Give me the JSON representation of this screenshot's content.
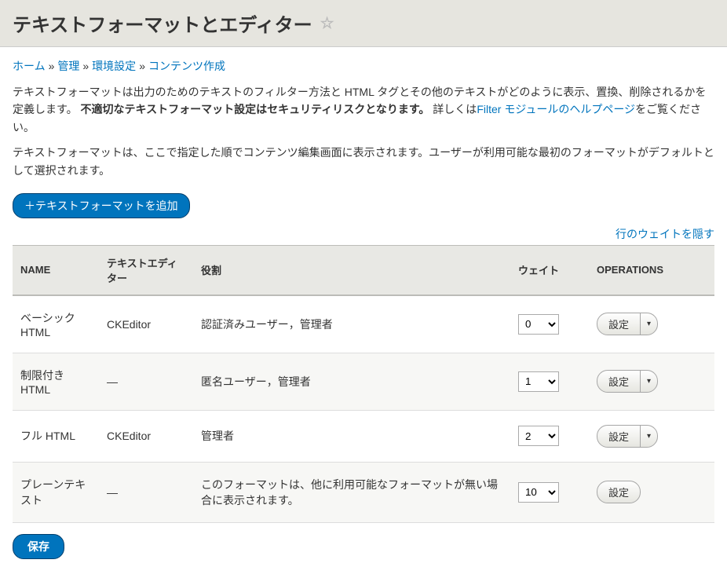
{
  "page": {
    "title": "テキストフォーマットとエディター"
  },
  "breadcrumb": {
    "items": [
      {
        "label": "ホーム"
      },
      {
        "label": "管理"
      },
      {
        "label": "環境設定"
      },
      {
        "label": "コンテンツ作成"
      }
    ],
    "sep": "»"
  },
  "desc": {
    "p1a": "テキストフォーマットは出力のためのテキストのフィルター方法と HTML タグとその他のテキストがどのように表示、置換、削除されるかを定義します。",
    "p1bold": "不適切なテキストフォーマット設定はセキュリティリスクとなります。",
    "p1b": " 詳しくは",
    "p1link": "Filter モジュールのヘルプページ",
    "p1c": "をご覧ください。",
    "p2": "テキストフォーマットは、ここで指定した順でコンテンツ編集画面に表示されます。ユーザーが利用可能な最初のフォーマットがデフォルトとして選択されます。"
  },
  "buttons": {
    "add": "＋テキストフォーマットを追加",
    "hide_weights": "行のウェイトを隠す",
    "save": "保存",
    "configure": "設定",
    "arrow": "▾"
  },
  "table": {
    "headers": {
      "name": "NAME",
      "editor": "テキストエディター",
      "roles": "役割",
      "weight": "ウェイト",
      "operations": "OPERATIONS"
    },
    "rows": [
      {
        "name": "ベーシック HTML",
        "editor": "CKEditor",
        "roles": "認証済みユーザー，管理者",
        "weight": "0",
        "has_arrow": true
      },
      {
        "name": "制限付き HTML",
        "editor": "—",
        "roles": "匿名ユーザー，管理者",
        "weight": "1",
        "has_arrow": true
      },
      {
        "name": "フル HTML",
        "editor": "CKEditor",
        "roles": "管理者",
        "weight": "2",
        "has_arrow": true
      },
      {
        "name": "プレーンテキスト",
        "editor": "—",
        "roles": "このフォーマットは、他に利用可能なフォーマットが無い場合に表示されます。",
        "weight": "10",
        "has_arrow": false
      }
    ]
  }
}
